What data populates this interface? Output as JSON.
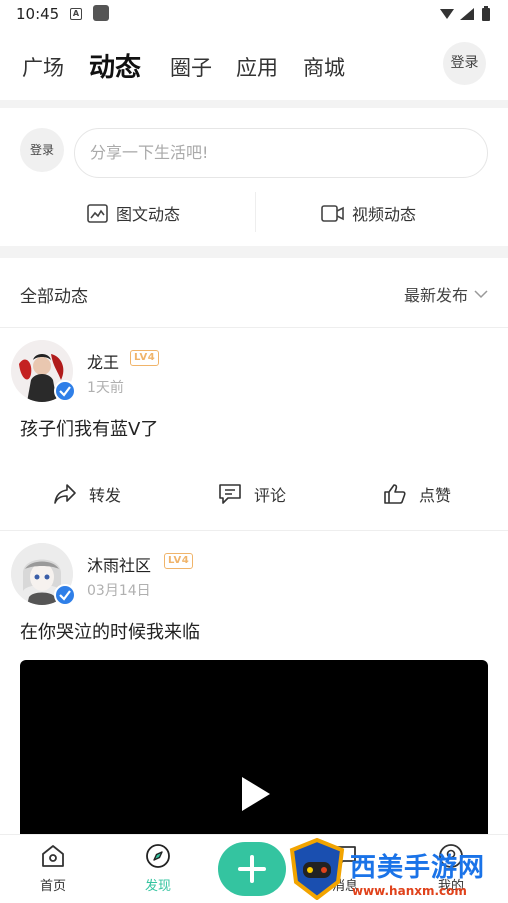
{
  "status_bar": {
    "time": "10:45",
    "a_icon": "A"
  },
  "top_nav": {
    "tabs": [
      {
        "label": "广场"
      },
      {
        "label": "动态"
      },
      {
        "label": "圈子"
      },
      {
        "label": "应用"
      },
      {
        "label": "商城"
      }
    ],
    "active_tab": "动态",
    "login_label": "登录"
  },
  "composer": {
    "login_label": "登录",
    "placeholder": "分享一下生活吧!",
    "image_post_label": "图文动态",
    "video_post_label": "视频动态"
  },
  "feed_header": {
    "title": "全部动态",
    "sort_label": "最新发布"
  },
  "posts": [
    {
      "username": "龙王",
      "level": "LV4",
      "time": "1天前",
      "text": "孩子们我有蓝V了",
      "verified": true
    },
    {
      "username": "沐雨社区",
      "level": "LV4",
      "time": "03月14日",
      "text": "在你哭泣的时候我来临",
      "verified": true,
      "has_video": true
    }
  ],
  "post_actions": {
    "share": "转发",
    "comment": "评论",
    "like": "点赞"
  },
  "bottom_nav": {
    "items": [
      {
        "label": "首页",
        "icon": "home-icon"
      },
      {
        "label": "发现",
        "icon": "compass-icon"
      },
      {
        "label": "消息",
        "icon": "message-icon"
      },
      {
        "label": "我的",
        "icon": "profile-icon"
      }
    ],
    "active": "发现"
  },
  "watermark": {
    "title": "西美手游网",
    "url": "www.hanxm.com"
  },
  "colors": {
    "accent": "#34c4a0",
    "verified": "#2f7fe8",
    "level_badge": "#f0b46a",
    "watermark_blue": "#1a73e8",
    "watermark_red": "#e0421b"
  }
}
